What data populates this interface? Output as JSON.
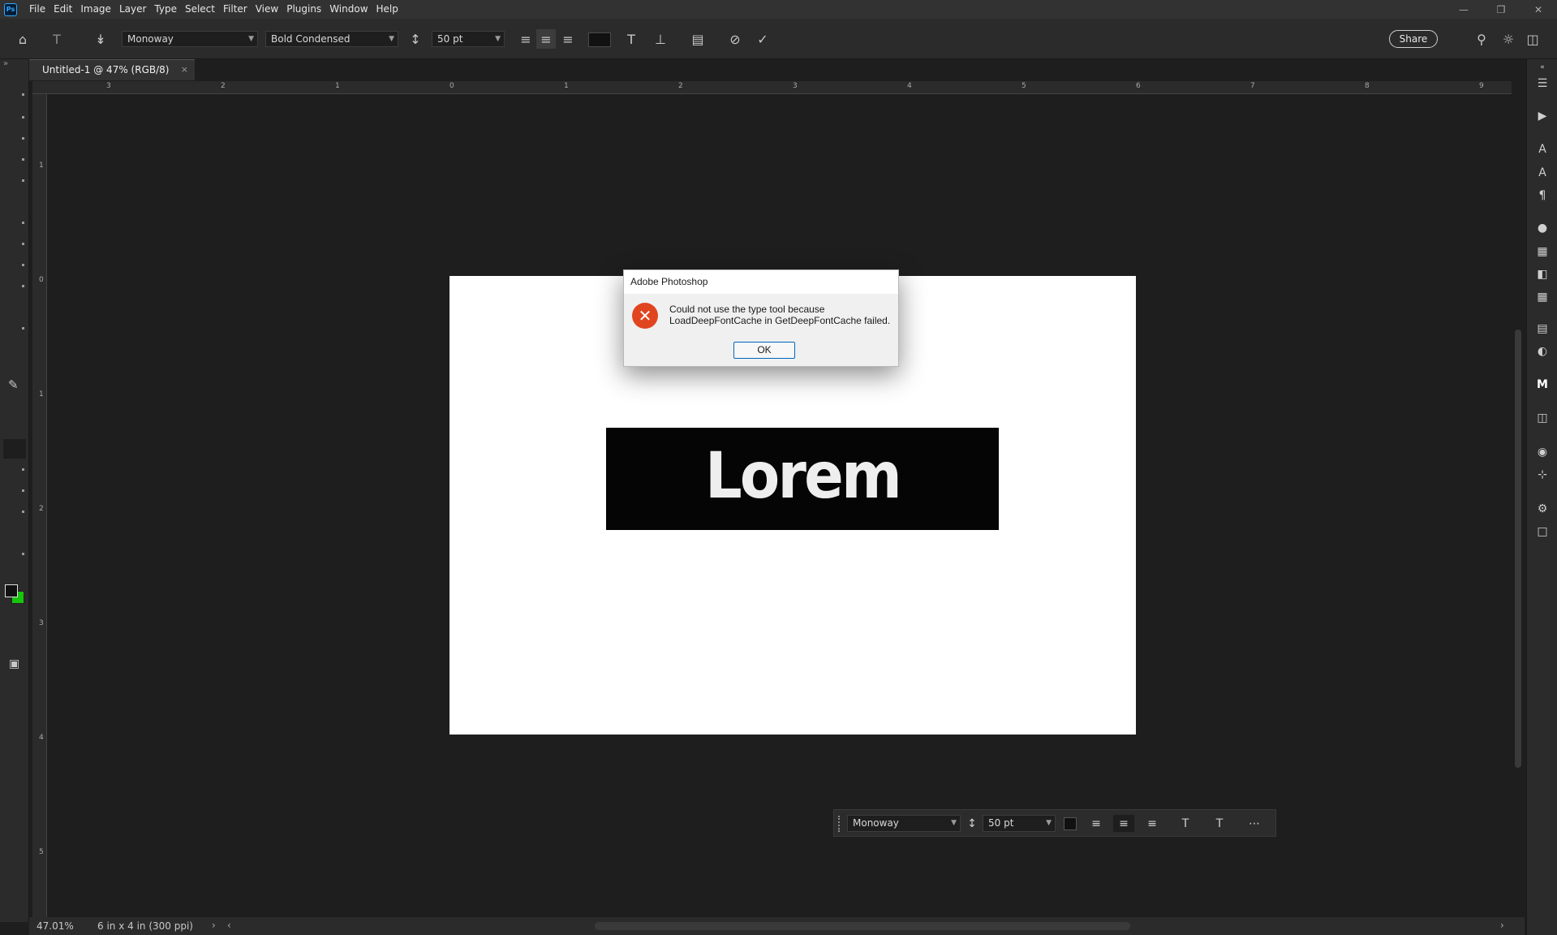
{
  "app": {
    "logo_text": "Ps",
    "menu": [
      "File",
      "Edit",
      "Image",
      "Layer",
      "Type",
      "Select",
      "Filter",
      "View",
      "Plugins",
      "Window",
      "Help"
    ]
  },
  "options_bar": {
    "font_family": "Monoway",
    "font_style": "Bold Condensed",
    "font_size": "50 pt",
    "share_label": "Share",
    "text_color": "#111111"
  },
  "document_tab": {
    "title": "Untitled-1 @ 47% (RGB/8)",
    "close": "×"
  },
  "rulers": {
    "horizontal": [
      "3",
      "2",
      "1",
      "0",
      "1",
      "2",
      "3",
      "4",
      "5",
      "6",
      "7",
      "8",
      "9"
    ],
    "vertical": [
      "1",
      "0",
      "1",
      "2",
      "3",
      "4",
      "5"
    ]
  },
  "canvas": {
    "text_layer": "Lorem Ipsum"
  },
  "dialog": {
    "title": "Adobe Photoshop",
    "message_line1": "Could not use the type tool because",
    "message_line2": "LoadDeepFontCache in GetDeepFontCache failed.",
    "ok_label": "OK",
    "error_icon": "error-icon"
  },
  "contextual_bar": {
    "font_family": "Monoway",
    "font_size": "50 pt"
  },
  "status_bar": {
    "zoom": "47.01%",
    "doc_info": "6 in x 4 in (300 ppi)",
    "arrow": "›"
  },
  "colors": {
    "foreground": "#111111",
    "background": "#16c60c"
  }
}
